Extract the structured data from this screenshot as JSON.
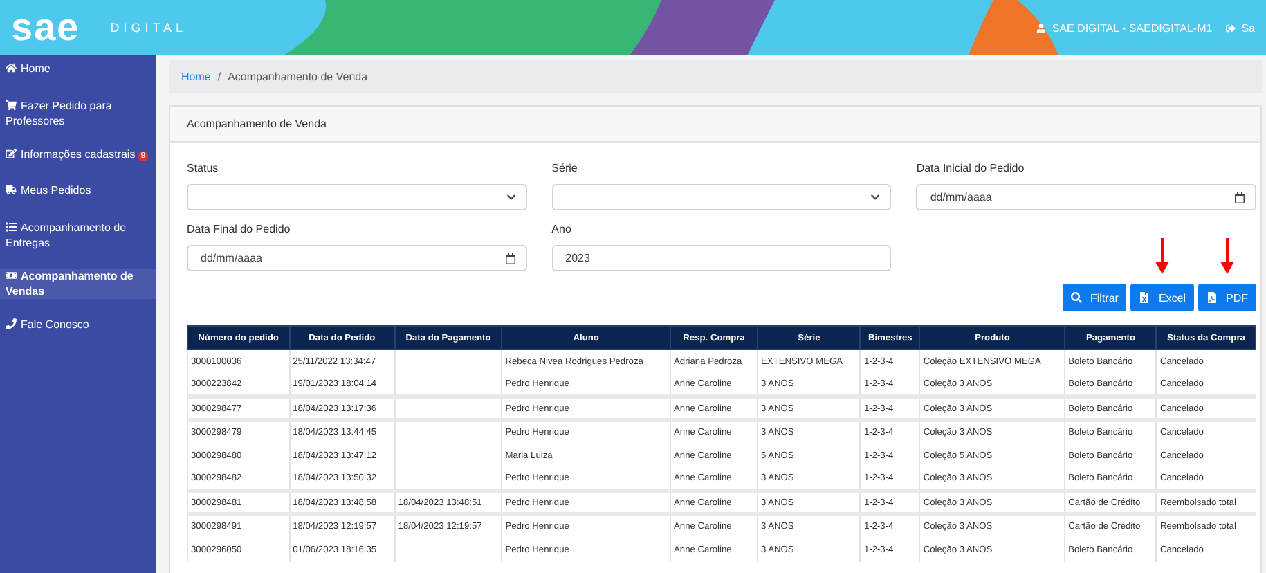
{
  "header": {
    "logo": "sae",
    "logo_sub": "DIGITAL",
    "user": "SAE DIGITAL - SAEDIGITAL-M1",
    "logout": "Sa"
  },
  "sidebar": {
    "items": [
      {
        "label": "Home",
        "selected": false
      },
      {
        "label": "Fazer Pedido para Professores",
        "selected": false
      },
      {
        "label": "Informações cadastrais",
        "badge": "9",
        "selected": false
      },
      {
        "label": "Meus Pedidos",
        "selected": false
      },
      {
        "label": "Acompanhamento de Entregas",
        "selected": false
      },
      {
        "label": "Acompanhamento de Vendas",
        "selected": true
      },
      {
        "label": "Fale Conosco",
        "selected": false
      }
    ]
  },
  "breadcrumb": {
    "items": [
      "Home",
      "Acompanhamento de Venda"
    ],
    "separator": "/"
  },
  "card": {
    "title": "Acompanhamento de Venda",
    "fields": [
      {
        "label": "Status",
        "kind": "select"
      },
      {
        "label": "Série",
        "kind": "select"
      },
      {
        "label": "Data Inicial do Pedido",
        "kind": "date",
        "placeholder": "dd/mm/aaaa"
      },
      {
        "label": "Data Final do Pedido",
        "kind": "date",
        "placeholder": "dd/mm/aaaa"
      },
      {
        "label": "Ano",
        "kind": "text",
        "value": "2023"
      }
    ],
    "buttons": [
      {
        "label": "Filtrar",
        "marked": false
      },
      {
        "label": "Excel",
        "marked": true
      },
      {
        "label": "PDF",
        "marked": true
      }
    ]
  },
  "table": {
    "columns": [
      "Número do pedido",
      "Data do Pedido",
      "Data do Pagamento",
      "Aluno",
      "Resp. Compra",
      "Série",
      "Bimestres",
      "Produto",
      "Pagamento",
      "Status da Compra"
    ],
    "groups": [
      [
        {
          "numero": "3000100036",
          "data_pedido": "25/11/2022 13:34:47",
          "aluno": "Rebeca Nivea Rodrigues Pedroza",
          "resp": "Adriana Pedroza",
          "serie": "EXTENSIVO MEGA",
          "bimestres": "1-2-3-4",
          "produto": "Coleção EXTENSIVO MEGA",
          "pagamento": "Boleto Bancário",
          "status": "Cancelado"
        },
        {
          "numero": "3000223842",
          "data_pedido": "19/01/2023 18:04:14",
          "aluno": "Pedro Henrique",
          "resp": "Anne Caroline",
          "serie": "3 ANOS",
          "bimestres": "1-2-3-4",
          "produto": "Coleção 3 ANOS",
          "pagamento": "Boleto Bancário",
          "status": "Cancelado"
        }
      ],
      [
        {
          "numero": "3000298477",
          "data_pedido": "18/04/2023 13:17:36",
          "aluno": "Pedro Henrique",
          "resp": "Anne Caroline",
          "serie": "3 ANOS",
          "bimestres": "1-2-3-4",
          "produto": "Coleção 3 ANOS",
          "pagamento": "Boleto Bancário",
          "status": "Cancelado"
        }
      ],
      [
        {
          "numero": "3000298479",
          "data_pedido": "18/04/2023 13:44:45",
          "aluno": "Pedro Henrique",
          "resp": "Anne Caroline",
          "serie": "3 ANOS",
          "bimestres": "1-2-3-4",
          "produto": "Coleção 3 ANOS",
          "pagamento": "Boleto Bancário",
          "status": "Cancelado"
        },
        {
          "numero": "3000298480",
          "data_pedido": "18/04/2023 13:47:12",
          "aluno": "Maria Luiza",
          "resp": "Anne Caroline",
          "serie": "5 ANOS",
          "bimestres": "1-2-3-4",
          "produto": "Coleção 5 ANOS",
          "pagamento": "Boleto Bancário",
          "status": "Cancelado"
        },
        {
          "numero": "3000298482",
          "data_pedido": "18/04/2023 13:50:32",
          "aluno": "Pedro Henrique",
          "resp": "Anne Caroline",
          "serie": "3 ANOS",
          "bimestres": "1-2-3-4",
          "produto": "Coleção 3 ANOS",
          "pagamento": "Boleto Bancário",
          "status": "Cancelado"
        }
      ],
      [
        {
          "numero": "3000298481",
          "data_pedido": "18/04/2023 13:48:58",
          "data_pagamento": "18/04/2023 13:48:51",
          "aluno": "Pedro Henrique",
          "resp": "Anne Caroline",
          "serie": "3 ANOS",
          "bimestres": "1-2-3-4",
          "produto": "Coleção 3 ANOS",
          "pagamento": "Cartão de Crédito",
          "status": "Reembolsado total"
        }
      ],
      [
        {
          "numero": "3000298491",
          "data_pedido": "18/04/2023 12:19:57",
          "data_pagamento": "18/04/2023 12:19:57",
          "aluno": "Pedro Henrique",
          "resp": "Anne Caroline",
          "serie": "3 ANOS",
          "bimestres": "1-2-3-4",
          "produto": "Coleção 3 ANOS",
          "pagamento": "Cartão de Crédito",
          "status": "Reembolsado total"
        },
        {
          "numero": "3000296050",
          "data_pedido": "01/06/2023 18:16:35",
          "aluno": "Pedro Henrique",
          "resp": "Anne Caroline",
          "serie": "3 ANOS",
          "bimestres": "1-2-3-4",
          "produto": "Coleção 3 ANOS",
          "pagamento": "Boleto Bancário",
          "status": "Cancelado"
        }
      ]
    ]
  }
}
